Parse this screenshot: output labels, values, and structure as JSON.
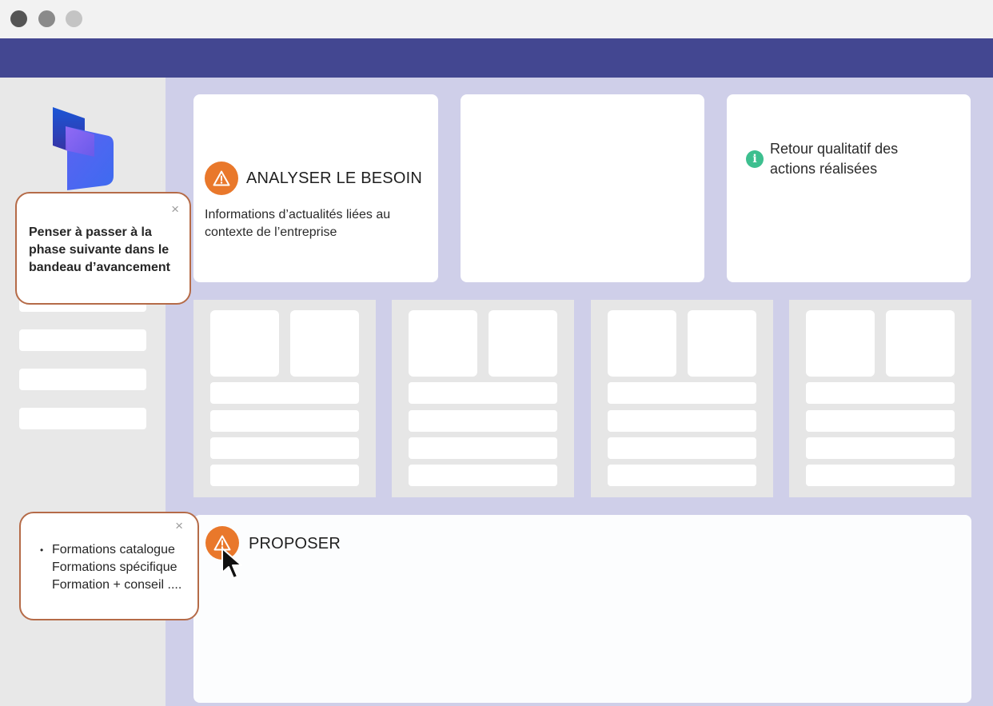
{
  "window": {
    "controls": [
      "close",
      "minimize",
      "maximize"
    ]
  },
  "colors": {
    "appbar": "#434791",
    "warning": "#e9782b",
    "info": "#3dbf8f",
    "tooltip_border": "#b56b48",
    "main_bg": "#cfcfe9"
  },
  "cards": {
    "analyser": {
      "icon": "warning-icon",
      "title": "ANALYSER LE BESOIN",
      "description_line1": "Informations d’actualités liées au",
      "description_line2": "contexte de l’entreprise"
    },
    "retour": {
      "icon": "info-icon",
      "info_glyph": "i",
      "text_line1": "Retour qualitatif des",
      "text_line2": "actions réalisées"
    },
    "proposer": {
      "icon": "warning-icon",
      "title": "PROPOSER"
    }
  },
  "tooltips": {
    "phase": {
      "close": "×",
      "text_line1": "Penser à passer à la",
      "text_line2": "phase suivante dans le",
      "text_line3": "bandeau d’avancement"
    },
    "formations": {
      "close": "×",
      "items": [
        "Formations catalogue",
        "Formations spécifique",
        "Formation + conseil ...."
      ]
    }
  },
  "icons": {
    "logo": "dynamics-logo-icon",
    "cursor": "mouse-pointer-icon"
  }
}
